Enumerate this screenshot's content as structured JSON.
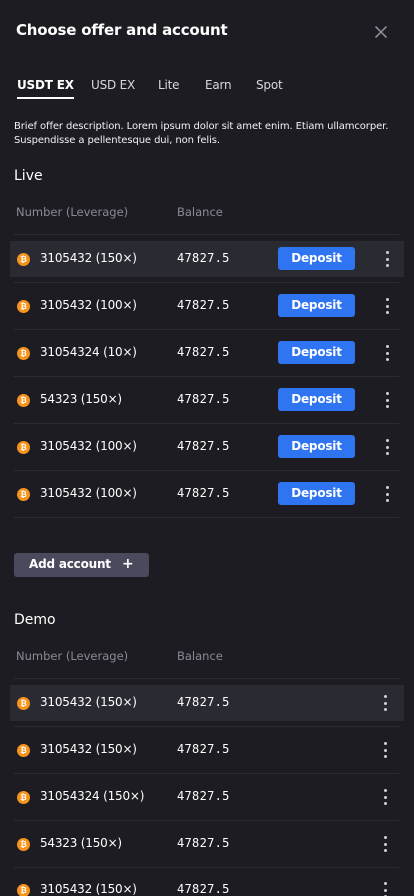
{
  "header": {
    "title": "Choose offer and account",
    "close_icon": "close-icon"
  },
  "tabs": [
    {
      "label": "USDT EX",
      "active": true
    },
    {
      "label": "USD EX",
      "active": false
    },
    {
      "label": "Lite",
      "active": false
    },
    {
      "label": "Earn",
      "active": false
    },
    {
      "label": "Spot",
      "active": false
    }
  ],
  "description": "Brief offer description. Lorem ipsum dolor sit amet enim. Etiam ullamcorper. Suspendisse a pellentesque dui, non felis.",
  "live": {
    "title": "Live",
    "col_number": "Number (Leverage)",
    "col_balance": "Balance",
    "rows": [
      {
        "account": "3105432 (150×)",
        "balance": "47827.5",
        "action": "Deposit"
      },
      {
        "account": "3105432 (100×)",
        "balance": "47827.5",
        "action": "Deposit"
      },
      {
        "account": "31054324 (10×)",
        "balance": "47827.5",
        "action": "Deposit"
      },
      {
        "account": "54323 (150×)",
        "balance": "47827.5",
        "action": "Deposit"
      },
      {
        "account": "3105432 (100×)",
        "balance": "47827.5",
        "action": "Deposit"
      },
      {
        "account": "3105432 (100×)",
        "balance": "47827.5",
        "action": "Deposit"
      }
    ]
  },
  "add_account": {
    "label": "Add account",
    "icon": "+"
  },
  "demo": {
    "title": "Demo",
    "col_number": "Number (Leverage)",
    "col_balance": "Balance",
    "rows": [
      {
        "account": "3105432 (150×)",
        "balance": "47827.5"
      },
      {
        "account": "3105432 (150×)",
        "balance": "47827.5"
      },
      {
        "account": "31054324 (150×)",
        "balance": "47827.5"
      },
      {
        "account": "54323 (150×)",
        "balance": "47827.5"
      },
      {
        "account": "3105432 (150×)",
        "balance": "47827.5"
      }
    ]
  },
  "colors": {
    "background": "#1c1c22",
    "accent": "#2f74f0",
    "bitcoin": "#f7931a",
    "highlight_row": "#2a2a32"
  }
}
